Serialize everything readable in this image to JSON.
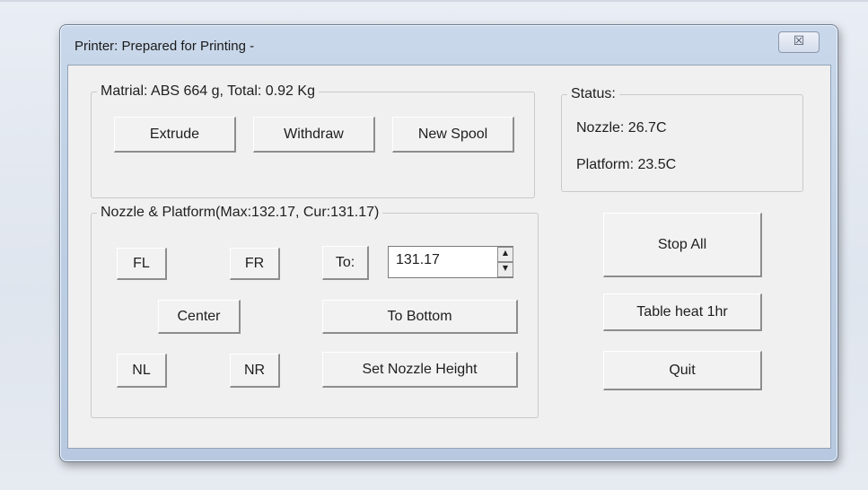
{
  "window": {
    "title": "Printer: Prepared for Printing -",
    "close_label": "☒"
  },
  "material": {
    "legend": "Matrial: ABS 664 g,  Total: 0.92 Kg",
    "extrude_label": "Extrude",
    "withdraw_label": "Withdraw",
    "new_spool_label": "New Spool"
  },
  "status": {
    "legend": "Status:",
    "nozzle": "Nozzle: 26.7C",
    "platform": "Platform: 23.5C"
  },
  "nozzle_platform": {
    "legend": "Nozzle & Platform(Max:132.17, Cur:131.17)",
    "fl_label": "FL",
    "fr_label": "FR",
    "to_label": "To:",
    "to_value": "131.17",
    "center_label": "Center",
    "to_bottom_label": "To Bottom",
    "nl_label": "NL",
    "nr_label": "NR",
    "set_nozzle_height_label": "Set Nozzle Height"
  },
  "actions": {
    "stop_all_label": "Stop All",
    "table_heat_label": "Table heat 1hr",
    "quit_label": "Quit"
  },
  "icons": {
    "spin_up": "▲",
    "spin_down": "▼"
  }
}
